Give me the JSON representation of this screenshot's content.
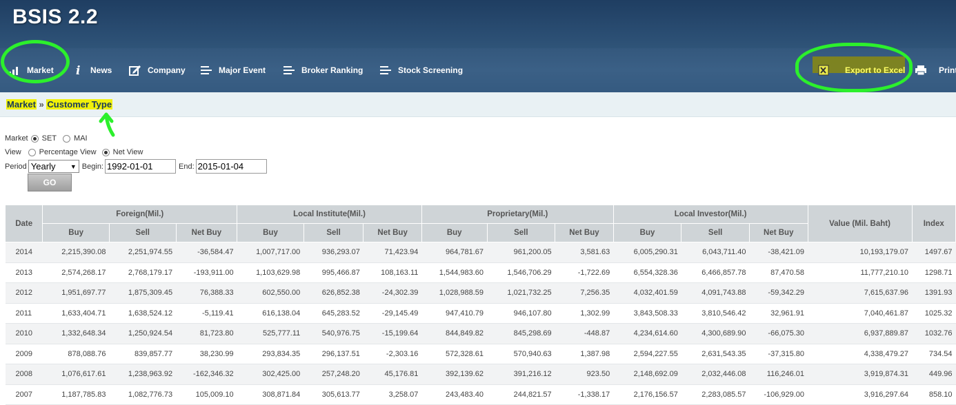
{
  "app": {
    "title": "BSIS 2.2"
  },
  "nav": {
    "items": [
      {
        "label": "Market",
        "icon": "bar-chart-icon"
      },
      {
        "label": "News",
        "icon": "info-icon"
      },
      {
        "label": "Company",
        "icon": "edit-icon"
      },
      {
        "label": "Major Event",
        "icon": "list-icon"
      },
      {
        "label": "Broker Ranking",
        "icon": "list-icon"
      },
      {
        "label": "Stock Screening",
        "icon": "list-icon"
      }
    ],
    "export_label": "Export to Excel",
    "print_label": "Print"
  },
  "breadcrumb": {
    "root": "Market",
    "sep": "»",
    "current": "Customer Type"
  },
  "form": {
    "market_label": "Market",
    "market_options": [
      "SET",
      "MAI"
    ],
    "market_selected": "SET",
    "view_label": "View",
    "view_options": [
      "Percentage View",
      "Net View"
    ],
    "view_selected": "Net View",
    "period_label": "Period",
    "period_value": "Yearly",
    "begin_label": "Begin:",
    "begin_value": "1992-01-01",
    "end_label": "End:",
    "end_value": "2015-01-04",
    "go_label": "GO"
  },
  "table": {
    "date_header": "Date",
    "groups": [
      "Foreign(Mil.)",
      "Local Institute(Mil.)",
      "Proprietary(Mil.)",
      "Local Investor(Mil.)"
    ],
    "sub_headers": [
      "Buy",
      "Sell",
      "Net Buy"
    ],
    "value_header": "Value (Mil. Baht)",
    "index_header": "Index",
    "rows": [
      [
        "2014",
        "2,215,390.08",
        "2,251,974.55",
        "-36,584.47",
        "1,007,717.00",
        "936,293.07",
        "71,423.94",
        "964,781.67",
        "961,200.05",
        "3,581.63",
        "6,005,290.31",
        "6,043,711.40",
        "-38,421.09",
        "10,193,179.07",
        "1497.67"
      ],
      [
        "2013",
        "2,574,268.17",
        "2,768,179.17",
        "-193,911.00",
        "1,103,629.98",
        "995,466.87",
        "108,163.11",
        "1,544,983.60",
        "1,546,706.29",
        "-1,722.69",
        "6,554,328.36",
        "6,466,857.78",
        "87,470.58",
        "11,777,210.10",
        "1298.71"
      ],
      [
        "2012",
        "1,951,697.77",
        "1,875,309.45",
        "76,388.33",
        "602,550.00",
        "626,852.38",
        "-24,302.39",
        "1,028,988.59",
        "1,021,732.25",
        "7,256.35",
        "4,032,401.59",
        "4,091,743.88",
        "-59,342.29",
        "7,615,637.96",
        "1391.93"
      ],
      [
        "2011",
        "1,633,404.71",
        "1,638,524.12",
        "-5,119.41",
        "616,138.04",
        "645,283.52",
        "-29,145.49",
        "947,410.79",
        "946,107.80",
        "1,302.99",
        "3,843,508.33",
        "3,810,546.42",
        "32,961.91",
        "7,040,461.87",
        "1025.32"
      ],
      [
        "2010",
        "1,332,648.34",
        "1,250,924.54",
        "81,723.80",
        "525,777.11",
        "540,976.75",
        "-15,199.64",
        "844,849.82",
        "845,298.69",
        "-448.87",
        "4,234,614.60",
        "4,300,689.90",
        "-66,075.30",
        "6,937,889.87",
        "1032.76"
      ],
      [
        "2009",
        "878,088.76",
        "839,857.77",
        "38,230.99",
        "293,834.35",
        "296,137.51",
        "-2,303.16",
        "572,328.61",
        "570,940.63",
        "1,387.98",
        "2,594,227.55",
        "2,631,543.35",
        "-37,315.80",
        "4,338,479.27",
        "734.54"
      ],
      [
        "2008",
        "1,076,617.61",
        "1,238,963.92",
        "-162,346.32",
        "302,425.00",
        "257,248.20",
        "45,176.81",
        "392,139.62",
        "391,216.12",
        "923.50",
        "2,148,692.09",
        "2,032,446.08",
        "116,246.01",
        "3,919,874.31",
        "449.96"
      ],
      [
        "2007",
        "1,187,785.83",
        "1,082,776.73",
        "105,009.10",
        "308,871.84",
        "305,613.77",
        "3,258.07",
        "243,483.40",
        "244,821.57",
        "-1,338.17",
        "2,176,156.57",
        "2,283,085.57",
        "-106,929.00",
        "3,916,297.64",
        "858.10"
      ]
    ]
  },
  "colors": {
    "negative": "#e0302a",
    "positive": "#2e9a4e",
    "annotation": "#2cf02c",
    "highlight": "#f1f10a"
  }
}
